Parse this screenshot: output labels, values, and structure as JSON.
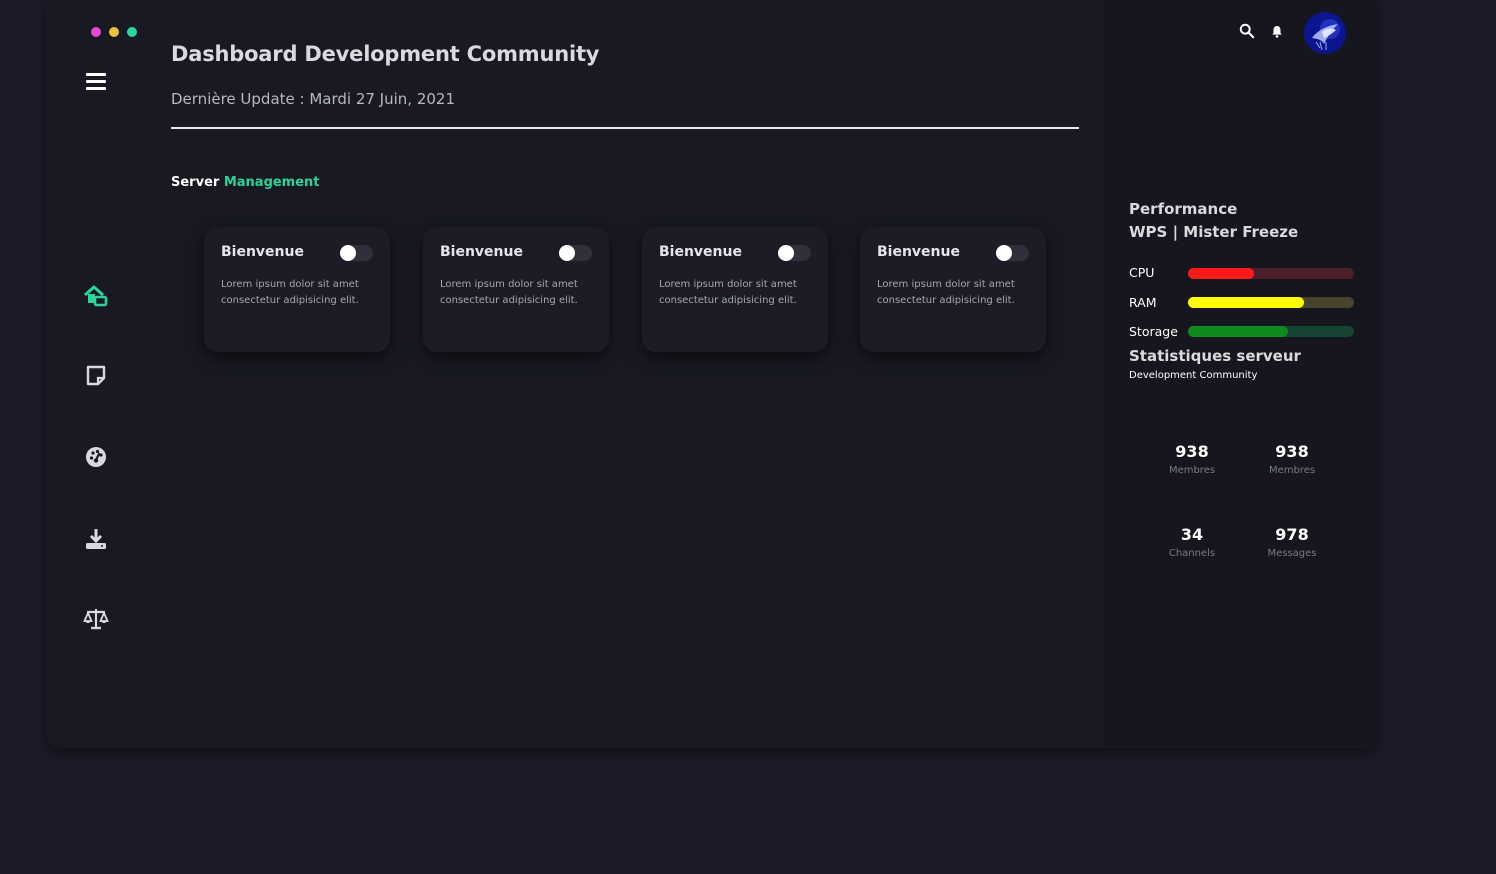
{
  "window": {
    "dots": [
      {
        "name": "dot-close",
        "color": "#e64ad8"
      },
      {
        "name": "dot-minimize",
        "color": "#e8c43a"
      },
      {
        "name": "dot-maximize",
        "color": "#2bd49b"
      }
    ]
  },
  "header": {
    "title": "Dashboard Development Community",
    "subtitle": "Dernière Update : Mardi 27 Juin, 2021"
  },
  "section": {
    "label": "Server",
    "accent_label": "Management",
    "accent_color": "#2bd49b"
  },
  "sidebar": {
    "items": [
      {
        "name": "home-icon",
        "active": true
      },
      {
        "name": "note-icon",
        "active": false
      },
      {
        "name": "dashboard-icon",
        "active": false
      },
      {
        "name": "download-icon",
        "active": false
      },
      {
        "name": "balance-scale-icon",
        "active": false
      }
    ],
    "active_color": "#2bd49b"
  },
  "cards": [
    {
      "title": "Bienvenue",
      "text": "Lorem ipsum dolor sit amet consectetur adipisicing elit.",
      "toggle_on": false
    },
    {
      "title": "Bienvenue",
      "text": "Lorem ipsum dolor sit amet consectetur adipisicing elit.",
      "toggle_on": false
    },
    {
      "title": "Bienvenue",
      "text": "Lorem ipsum dolor sit amet consectetur adipisicing elit.",
      "toggle_on": false
    },
    {
      "title": "Bienvenue",
      "text": "Lorem ipsum dolor sit amet consectetur adipisicing elit.",
      "toggle_on": false
    }
  ],
  "topbar": {
    "icons": [
      "search-icon",
      "bell-icon"
    ]
  },
  "performance": {
    "title": "Performance",
    "server_name": "WPS | Mister Freeze",
    "bars": [
      {
        "label": "CPU",
        "percent": 40,
        "fill": "#ff1a1a",
        "track": "#4a1f2a"
      },
      {
        "label": "RAM",
        "percent": 70,
        "fill": "#ffff00",
        "track": "#48442c"
      },
      {
        "label": "Storage",
        "percent": 60,
        "fill": "#0f8a1f",
        "track": "#174534"
      }
    ]
  },
  "stats": {
    "title": "Statistiques serveur",
    "subtitle": "Development Community",
    "items": [
      {
        "value": "938",
        "label": "Membres"
      },
      {
        "value": "938",
        "label": "Membres"
      },
      {
        "value": "34",
        "label": "Channels"
      },
      {
        "value": "978",
        "label": "Messages"
      }
    ]
  }
}
